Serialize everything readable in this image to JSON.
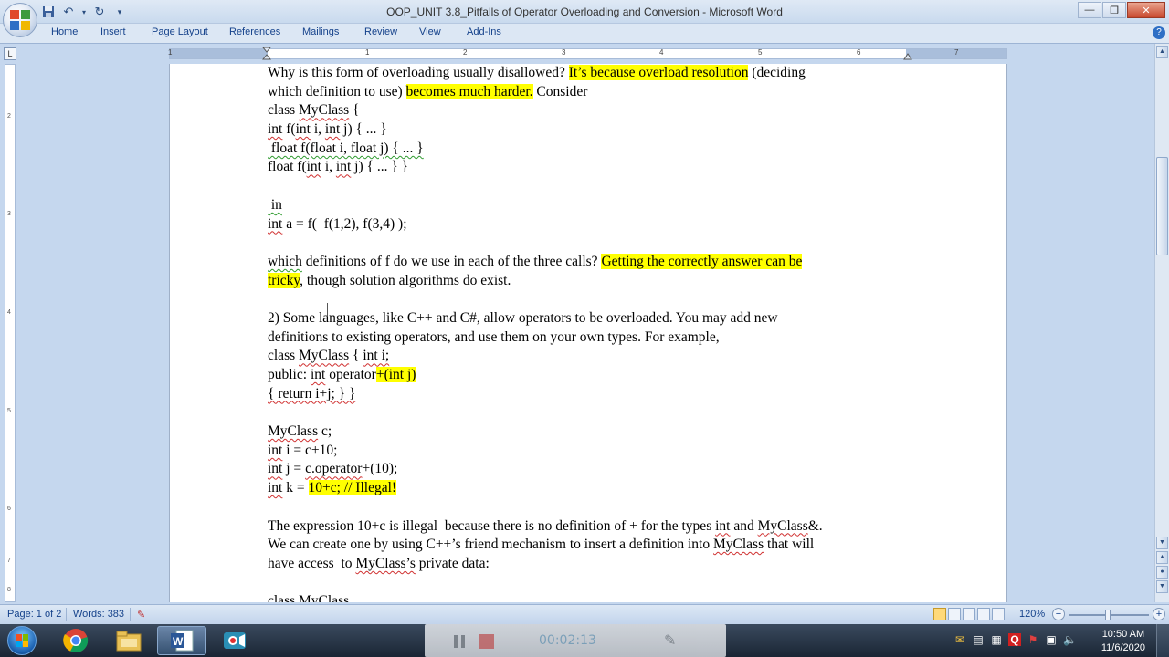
{
  "window": {
    "title": "OOP_UNIT 3.8_Pitfalls of Operator Overloading and Conversion - Microsoft Word",
    "minimize": "—",
    "restore": "❐",
    "close": "✕"
  },
  "quick_access": [
    "save-icon",
    "undo-icon",
    "redo-icon",
    "customize-icon"
  ],
  "ribbon": {
    "tabs": [
      "Home",
      "Insert",
      "Page Layout",
      "References",
      "Mailings",
      "Review",
      "View",
      "Add-Ins"
    ],
    "help": "?"
  },
  "ruler": {
    "corner": "L",
    "numbers": [
      "1",
      "1",
      "2",
      "3",
      "4",
      "5",
      "6",
      "7"
    ],
    "vertical_numbers": [
      "2",
      "3",
      "4",
      "5",
      "6",
      "7",
      "8"
    ]
  },
  "document": {
    "lines": [
      [
        {
          "t": "Why is this form of overloading usually disallowed? "
        },
        {
          "t": "It’s because overload resolution",
          "hl": true
        },
        {
          "t": " (deciding"
        }
      ],
      [
        {
          "t": "which definition to use) "
        },
        {
          "t": "becomes much harder.",
          "hl": true
        },
        {
          "t": " Consider"
        }
      ],
      [
        {
          "t": "class "
        },
        {
          "t": "MyClass",
          "sq": true
        },
        {
          "t": " {"
        }
      ],
      [
        {
          "t": "int",
          "sq": true
        },
        {
          "t": " f("
        },
        {
          "t": "int",
          "sq": true
        },
        {
          "t": " i, "
        },
        {
          "t": "int",
          "sq": true
        },
        {
          "t": " j) { ... }"
        }
      ],
      [
        {
          "t": " float f(float i, float j) { ... }",
          "gsq": true
        }
      ],
      [
        {
          "t": "float f("
        },
        {
          "t": "int",
          "sq": true
        },
        {
          "t": " i, "
        },
        {
          "t": "int",
          "sq": true
        },
        {
          "t": " j) { ... } }"
        }
      ],
      [
        {
          "t": ""
        }
      ],
      [
        {
          "t": " in",
          "gsq": true
        }
      ],
      [
        {
          "t": "int",
          "sq": true
        },
        {
          "t": " a = f(  f(1,2), f(3,4) );"
        }
      ],
      [
        {
          "t": ""
        }
      ],
      [
        {
          "t": "which",
          "gsq": true
        },
        {
          "t": " definitions of f do we use in each of the three calls? "
        },
        {
          "t": "Getting the correctly answer can be",
          "hl": true
        }
      ],
      [
        {
          "t": "tricky",
          "hl": true
        },
        {
          "t": ", though solution algorithms do exist."
        }
      ],
      [
        {
          "t": ""
        }
      ],
      [
        {
          "t": "2) Some languages, like C++ and C#, allow operators to be overloaded. You may add new"
        }
      ],
      [
        {
          "t": "definitions to existing operators, and use them on your own types. For example,"
        }
      ],
      [
        {
          "t": "class "
        },
        {
          "t": "MyClass",
          "sq": true
        },
        {
          "t": " { "
        },
        {
          "t": "int i;",
          "sq": true
        }
      ],
      [
        {
          "t": "public: "
        },
        {
          "t": "int",
          "sq": true
        },
        {
          "t": " operator"
        },
        {
          "t": "+(int j)",
          "hl": true
        }
      ],
      [
        {
          "t": "{ return i+j; } }",
          "sq": true
        }
      ],
      [
        {
          "t": ""
        }
      ],
      [
        {
          "t": "MyClass",
          "sq": true
        },
        {
          "t": " c;"
        }
      ],
      [
        {
          "t": "int",
          "sq": true
        },
        {
          "t": " i = c+10;"
        }
      ],
      [
        {
          "t": "int",
          "sq": true
        },
        {
          "t": " j = "
        },
        {
          "t": "c.operator",
          "sq": true
        },
        {
          "t": "+(10);"
        }
      ],
      [
        {
          "t": "int",
          "sq": true
        },
        {
          "t": " k = "
        },
        {
          "t": "10+c; // Illegal!",
          "hl": true
        }
      ],
      [
        {
          "t": ""
        }
      ],
      [
        {
          "t": "The expression 10+c is illegal  because there is no definition of + for the types "
        },
        {
          "t": "int",
          "sq": true
        },
        {
          "t": " and "
        },
        {
          "t": "MyClass",
          "sq": true
        },
        {
          "t": "&."
        }
      ],
      [
        {
          "t": "We can create one by using C++’s friend mechanism to insert a definition into "
        },
        {
          "t": "MyClass",
          "sq": true
        },
        {
          "t": " that will"
        }
      ],
      [
        {
          "t": "have access  to "
        },
        {
          "t": "MyClass’s",
          "sq": true
        },
        {
          "t": " private data:"
        }
      ],
      [
        {
          "t": ""
        }
      ],
      [
        {
          "t": "class "
        },
        {
          "t": "MyClass",
          "sq": true
        }
      ]
    ]
  },
  "status": {
    "page": "Page: 1 of 2",
    "words": "Words: 383",
    "zoom": "120%",
    "zoom_minus": "−",
    "zoom_plus": "+"
  },
  "recorder": {
    "time": "00:02:13"
  },
  "taskbar": {
    "apps": [
      "chrome-icon",
      "file-explorer-icon",
      "word-icon",
      "screen-recorder-icon"
    ],
    "clock_time": "10:50 AM",
    "clock_date": "11/6/2020"
  },
  "colors": {
    "highlight": "#ffff00",
    "spell_error": "#d03030",
    "grammar_error": "#2e9a2e"
  }
}
